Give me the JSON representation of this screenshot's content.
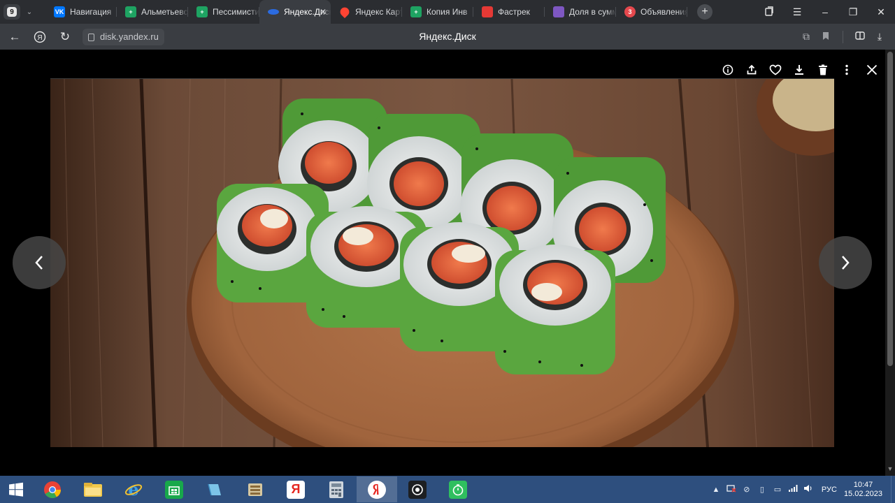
{
  "browser": {
    "tab_count": "9",
    "tabs": [
      {
        "title": "Навигация",
        "favicon": "vk",
        "color": "#0077ff",
        "glyph": "VK"
      },
      {
        "title": "Альметьевск",
        "favicon": "sheets",
        "color": "#1ea362",
        "glyph": "+"
      },
      {
        "title": "Пессимистичный",
        "favicon": "sheets",
        "color": "#1ea362",
        "glyph": "+"
      },
      {
        "title": "Яндекс.Диск",
        "favicon": "yandex-disk",
        "color": "#2b6be0",
        "glyph": "",
        "active": true
      },
      {
        "title": "Яндекс Карты",
        "favicon": "maps",
        "color": "#ff4433",
        "glyph": ""
      },
      {
        "title": "Копия Инв",
        "favicon": "sheets",
        "color": "#1ea362",
        "glyph": "+"
      },
      {
        "title": "Фастрек",
        "favicon": "fastrack",
        "color": "#e53935",
        "glyph": ""
      },
      {
        "title": "Доля в сумме",
        "favicon": "dots",
        "color": "#7e57c2",
        "glyph": ""
      },
      {
        "title": "Объявления",
        "favicon": "avito-badge",
        "color": "#e5484d",
        "glyph": "3"
      }
    ],
    "url": "disk.yandex.ru",
    "page_title": "Яндекс.Диск"
  },
  "viewer": {
    "toolbar": [
      "info-icon",
      "share-icon",
      "heart-icon",
      "download-icon",
      "trash-icon",
      "more-icon",
      "close-icon"
    ],
    "image_description": "sushi rolls on wooden board"
  },
  "taskbar": {
    "apps": [
      "chrome",
      "explorer",
      "ie",
      "store",
      "ebook",
      "archive",
      "yandex-browser",
      "calculator",
      "yandex",
      "camera",
      "timer"
    ],
    "language": "РУС",
    "time": "10:47",
    "date": "15.02.2023"
  }
}
